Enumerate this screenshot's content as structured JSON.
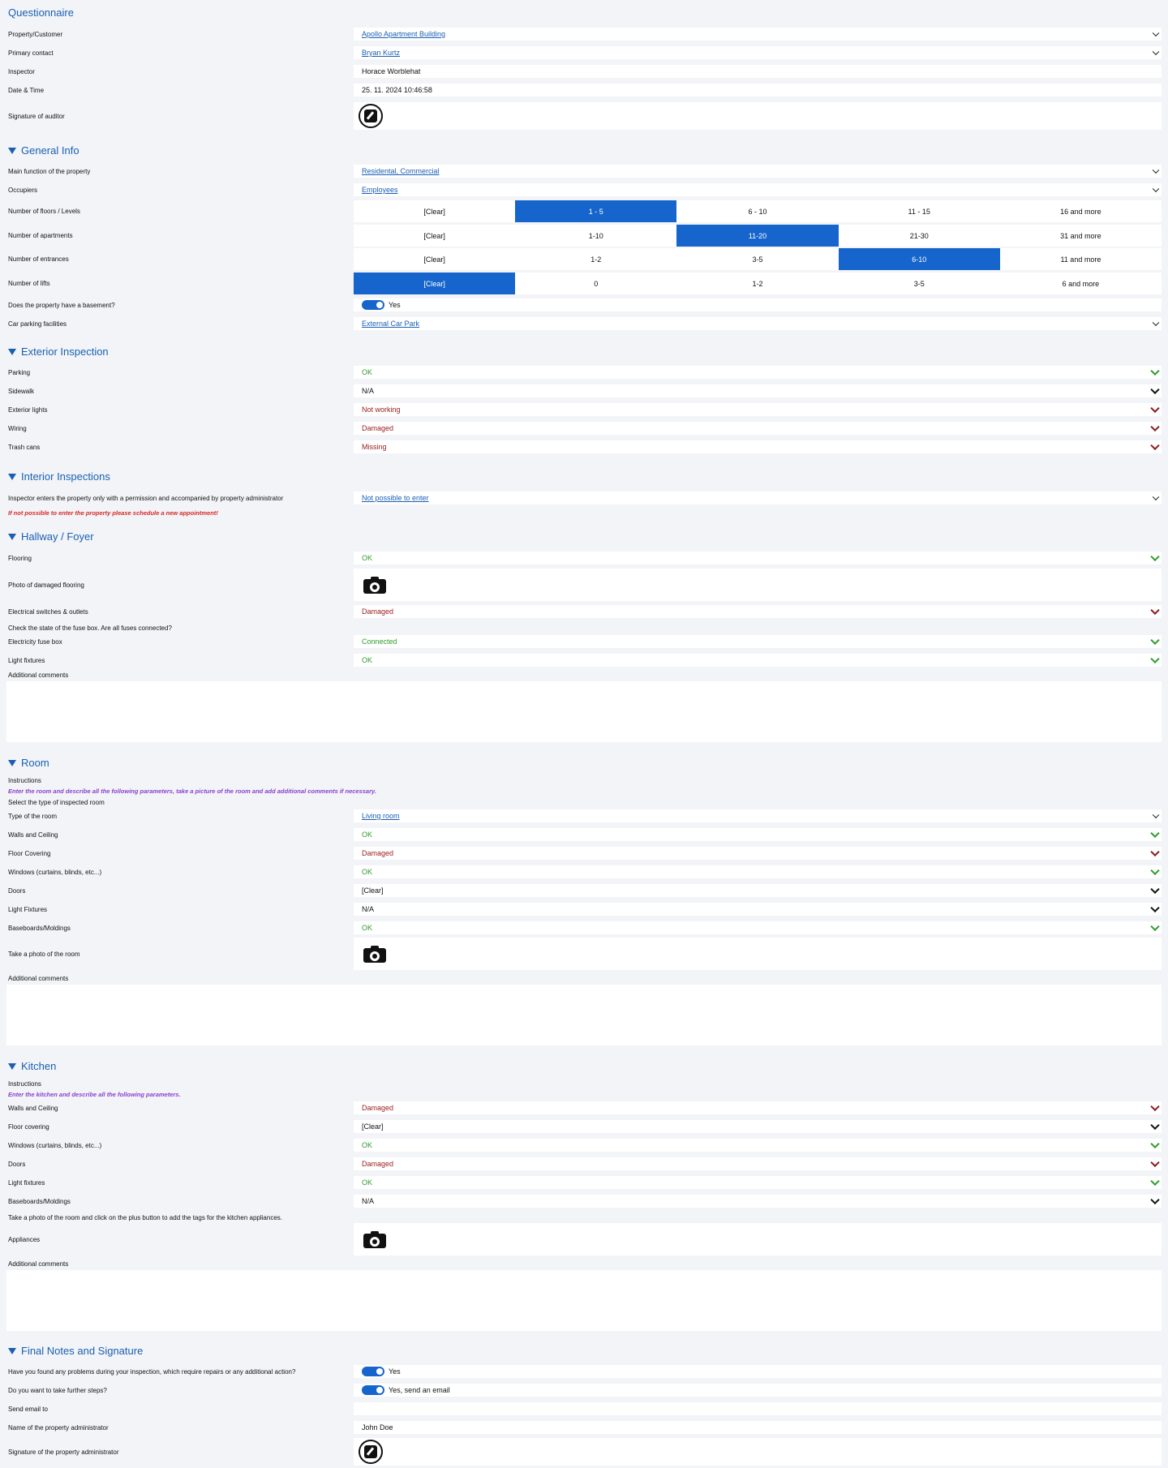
{
  "title": "Questionnaire",
  "header": [
    {
      "label": "Property/Customer",
      "value": "Apollo Apartment Building",
      "type": "link"
    },
    {
      "label": "Primary contact",
      "value": "Bryan Kurtz",
      "type": "link"
    },
    {
      "label": "Inspector",
      "value": "Horace Worblehat",
      "type": "text"
    },
    {
      "label": "Date & Time",
      "value": "25. 11. 2024 10:46:58",
      "type": "text"
    },
    {
      "label": "Signature of auditor",
      "type": "signature"
    }
  ],
  "general_info": {
    "title": "General Info",
    "main_function": {
      "label": "Main function of the property",
      "value": "Residental, Commercial"
    },
    "occupiers": {
      "label": "Occupiers",
      "value": "Employees"
    },
    "segments": [
      {
        "label": "Number of floors / Levels",
        "options": [
          "[Clear]",
          "1 - 5",
          "6 - 10",
          "11 - 15",
          "16 and more"
        ],
        "selected": 1
      },
      {
        "label": "Number of apartments",
        "options": [
          "[Clear]",
          "1-10",
          "11-20",
          "21-30",
          "31 and more"
        ],
        "selected": 2
      },
      {
        "label": "Number of entrances",
        "options": [
          "[Clear]",
          "1-2",
          "3-5",
          "6-10",
          "11 and more"
        ],
        "selected": 3
      },
      {
        "label": "Number of lifts",
        "options": [
          "[Clear]",
          "0",
          "1-2",
          "3-5",
          "6 and more"
        ],
        "selected": 0
      }
    ],
    "basement": {
      "label": "Does the property have a basement?",
      "value": "Yes"
    },
    "parking": {
      "label": "Car parking facilities",
      "value": "External Car Park"
    }
  },
  "exterior": {
    "title": "Exterior Inspection",
    "items": [
      {
        "label": "Parking",
        "value": "OK",
        "status": "ok"
      },
      {
        "label": "Sidewalk",
        "value": "N/A",
        "status": "na"
      },
      {
        "label": "Exterior lights",
        "value": "Not working",
        "status": "bad"
      },
      {
        "label": "Wiring",
        "value": "Damaged",
        "status": "bad"
      },
      {
        "label": "Trash cans",
        "value": "Missing",
        "status": "bad"
      }
    ]
  },
  "interior": {
    "title": "Interior Inspections",
    "permission_label": "Inspector enters the property only with a permission and accompanied by property administrator",
    "permission_value": "Not possible to enter",
    "note": "If not possible to enter the property please schedule a new appointment!"
  },
  "hallway": {
    "title": "Hallway / Foyer",
    "flooring": {
      "label": "Flooring",
      "value": "OK"
    },
    "photo_label": "Photo of damaged flooring",
    "switches": {
      "label": "Electrical switches & outlets",
      "value": "Damaged"
    },
    "fuse_question": "Check the state of the fuse box. Are all fuses connected?",
    "fuse": {
      "label": "Electricity fuse box",
      "value": "Connected"
    },
    "lights": {
      "label": "Light fixtures",
      "value": "OK"
    },
    "comments_label": "Additional comments"
  },
  "room": {
    "title": "Room",
    "instructions_label": "Instructions",
    "instructions": "Enter the room and describe all the following parameters, take a picture of the room and add additional comments if necessary.",
    "select_label": "Select the type of inspected room",
    "type": {
      "label": "Type of the room",
      "value": "Living room"
    },
    "items": [
      {
        "label": "Walls and Ceiling",
        "value": "OK",
        "status": "ok"
      },
      {
        "label": "Floor Covering",
        "value": "Damaged",
        "status": "bad"
      },
      {
        "label": "Windows (curtains, blinds, etc...)",
        "value": "OK",
        "status": "ok"
      },
      {
        "label": "Doors",
        "value": "[Clear]",
        "status": "na"
      },
      {
        "label": "Light Fixtures",
        "value": "N/A",
        "status": "na"
      },
      {
        "label": "Baseboards/Moldings",
        "value": "OK",
        "status": "ok"
      }
    ],
    "photo_label": "Take a photo of the room",
    "comments_label": "Additional comments"
  },
  "kitchen": {
    "title": "Kitchen",
    "instructions_label": "Instructions",
    "instructions": "Enter the kitchen and describe all the following parameters.",
    "items": [
      {
        "label": "Walls and Ceiling",
        "value": "Damaged",
        "status": "bad"
      },
      {
        "label": "Floor covering",
        "value": "[Clear]",
        "status": "na"
      },
      {
        "label": "Windows (curtains, blinds, etc...)",
        "value": "OK",
        "status": "ok"
      },
      {
        "label": "Doors",
        "value": "Damaged",
        "status": "bad"
      },
      {
        "label": "Light fixtures",
        "value": "OK",
        "status": "ok"
      },
      {
        "label": "Baseboards/Moldings",
        "value": "N/A",
        "status": "na"
      }
    ],
    "photo_instruction": "Take a photo of the room and click on the plus button to add the tags for the kitchen appliances.",
    "appliances_label": "Appliances",
    "comments_label": "Additional comments"
  },
  "final": {
    "title": "Final Notes and Signature",
    "problems": {
      "label": "Have you found any problems during your inspection, which require repairs or any additional action?",
      "value": "Yes"
    },
    "further": {
      "label": "Do you want to take further steps?",
      "value": "Yes, send an email"
    },
    "email": {
      "label": "Send email to",
      "value": ""
    },
    "admin": {
      "label": "Name of the property administrator",
      "value": "John Doe"
    },
    "signature_label": "Signature of the property administrator"
  }
}
